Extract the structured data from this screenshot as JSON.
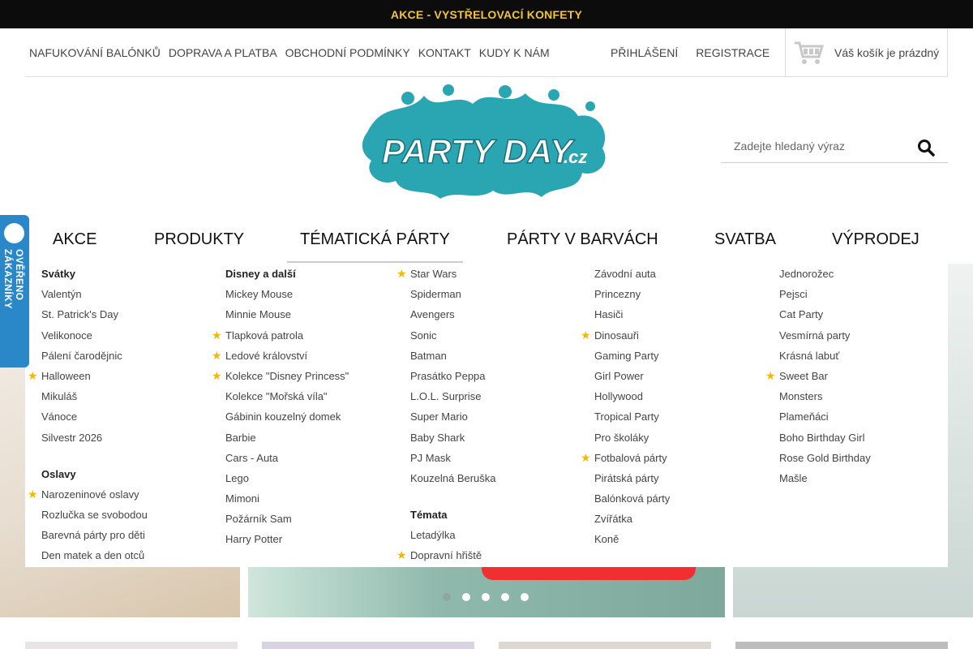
{
  "promo": "AKCE - VYSTŘELOVACÍ KONFETY",
  "topnav": [
    "NAFUKOVÁNÍ BALÓNKŮ",
    "DOPRAVA A PLATBA",
    "OBCHODNÍ PODMÍNKY",
    "KONTAKT",
    "KUDY K NÁM"
  ],
  "auth": {
    "login": "PŘIHLÁŠENÍ",
    "register": "REGISTRACE"
  },
  "cart": {
    "text": "Váš košík je prázdný",
    "icon": "cart-icon"
  },
  "search": {
    "placeholder": "Zadejte hledaný výraz",
    "icon": "search-icon"
  },
  "logo": {
    "text": "PARTY DAY",
    "suffix": ".cz",
    "color": "#2aa6b3"
  },
  "badge": {
    "text": "OVĚŘENO ZÁKAZNÍKY",
    "color": "#2a87c8"
  },
  "mainnav": [
    "AKCE",
    "PRODUKTY",
    "TÉMATICKÁ PÁRTY",
    "PÁRTY V BARVÁCH",
    "SVATBA",
    "VÝPRODEJ"
  ],
  "active_tab": "TÉMATICKÁ PÁRTY",
  "menu": {
    "col1": {
      "head1": "Svátky",
      "items1": [
        "Valentýn",
        "St. Patrick's Day",
        "Velikonoce",
        "Pálení čarodějnic",
        "Halloween",
        "Mikuláš",
        "Vánoce",
        "Silvestr 2026"
      ],
      "head2": "Oslavy",
      "items2": [
        "Narozeninové oslavy",
        "Rozlučka se svobodou",
        "Barevná párty pro děti",
        "Den matek a den otců"
      ]
    },
    "col2": {
      "head1": "Disney a další",
      "items1": [
        "Mickey Mouse",
        "Minnie Mouse",
        "Tlapková patrola",
        "Ledové království",
        "Kolekce \"Disney Princess\"",
        "Kolekce \"Mořská víla\"",
        "Gábinin kouzelný domek",
        "Barbie",
        "Cars - Auta",
        "Lego",
        "Mimoni",
        "Požárník Sam",
        "Harry Potter"
      ]
    },
    "col3": {
      "items1": [
        "Star Wars",
        "Spiderman",
        "Avengers",
        "Sonic",
        "Batman",
        "Prasátko Peppa",
        "L.O.L. Surprise",
        "Super Mario",
        "Baby Shark",
        "PJ Mask",
        "Kouzelná Beruška"
      ],
      "head2": "Témata",
      "items2": [
        "Letadýlka",
        "Dopravní hřiště"
      ]
    },
    "col4": {
      "items1": [
        "Závodní auta",
        "Princezny",
        "Hasiči",
        "Dinosauři",
        "Gaming Party",
        "Girl Power",
        "Hollywood",
        "Tropical Party",
        "Pro školáky",
        "Fotbalová párty",
        "Pirátská párty",
        "Balónková párty",
        "Zvířátka",
        "Koně"
      ]
    },
    "col5": {
      "items1": [
        "Jednorožec",
        "Pejsci",
        "Cat Party",
        "Vesmírná party",
        "Krásná labuť",
        "Sweet Bar",
        "Monsters",
        "Plameňáci",
        "Boho Birthday Girl",
        "Rose Gold Birthday",
        "Mašle"
      ]
    }
  },
  "slider": {
    "count": 5,
    "active": 1
  },
  "colors": {
    "topbar_bg": "#0c0c0c",
    "promo_text": "#f0c43a",
    "star": "#f5b800"
  }
}
